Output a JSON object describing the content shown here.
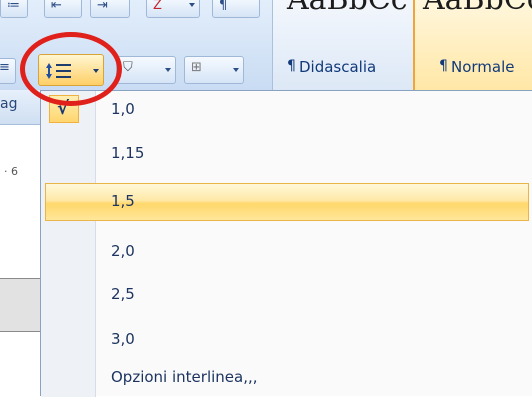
{
  "ribbon": {
    "styles": [
      {
        "preview": "AaBbCc",
        "name": "Didascalia",
        "mark": "¶"
      },
      {
        "preview": "AaBbCcL",
        "name": "Normale",
        "mark": "¶"
      }
    ],
    "line_spacing_icon": "line-spacing-icon"
  },
  "document": {
    "tab_label": "ag",
    "ruler_text": "· 6"
  },
  "menu": {
    "checked_mark": "√",
    "items": [
      {
        "label": "1,0",
        "selected": false
      },
      {
        "label": "1,15",
        "selected": false
      },
      {
        "label": "1,5",
        "selected": true
      },
      {
        "label": "2,0",
        "selected": false
      },
      {
        "label": "2,5",
        "selected": false
      },
      {
        "label": "3,0",
        "selected": false
      },
      {
        "label": "Opzioni interlinea,,,",
        "selected": false
      }
    ]
  },
  "colors": {
    "highlight": "#ffd86b",
    "annotation_circle": "#e0201a",
    "menu_text": "#1d3461"
  }
}
